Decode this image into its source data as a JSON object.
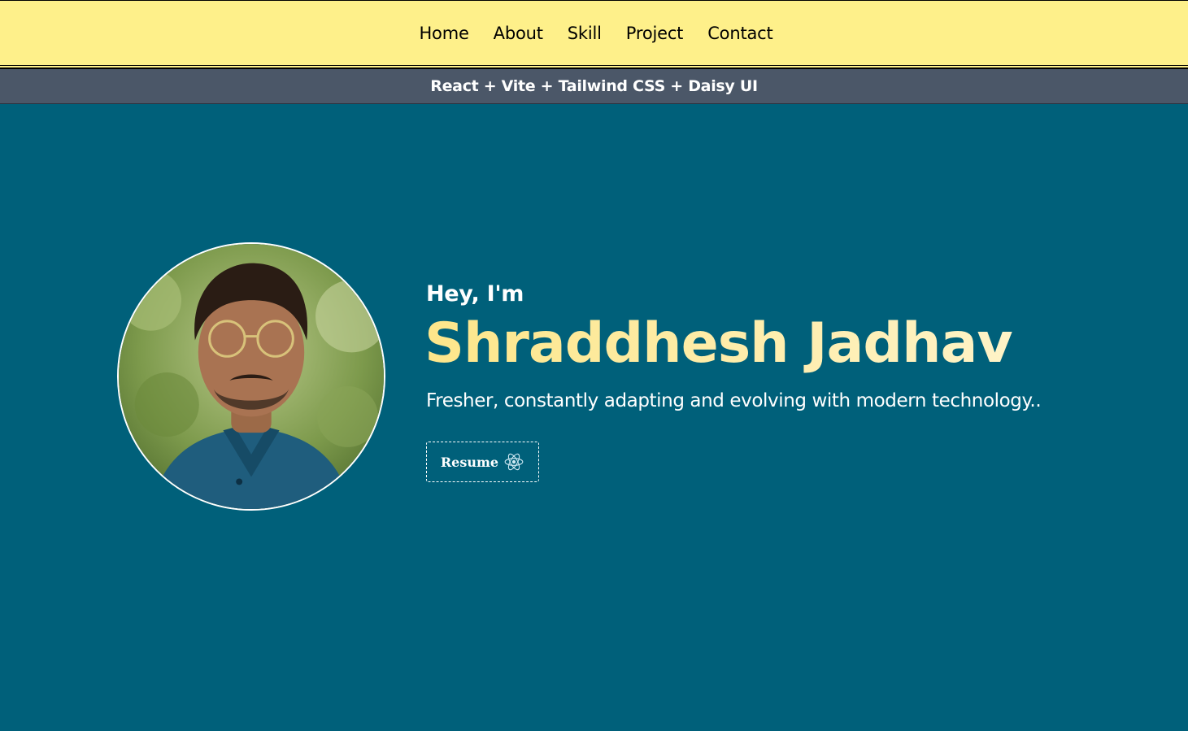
{
  "nav": {
    "items": [
      {
        "label": "Home"
      },
      {
        "label": "About"
      },
      {
        "label": "Skill"
      },
      {
        "label": "Project"
      },
      {
        "label": "Contact"
      }
    ]
  },
  "banner": {
    "text": "React + Vite + Tailwind CSS + Daisy UI"
  },
  "hero": {
    "greeting": "Hey, I'm",
    "name": "Shraddhesh Jadhav",
    "tagline": "Fresher, constantly adapting and evolving with modern technology..",
    "resume_label": "Resume",
    "resume_icon": "react-atom-icon",
    "avatar": "profile-photo"
  },
  "colors": {
    "nav_bg": "#fef08a",
    "banner_bg": "#4b5768",
    "hero_bg": "#00607a",
    "name_gradient_start": "#fde68a",
    "name_gradient_end": "#fef3c7"
  }
}
